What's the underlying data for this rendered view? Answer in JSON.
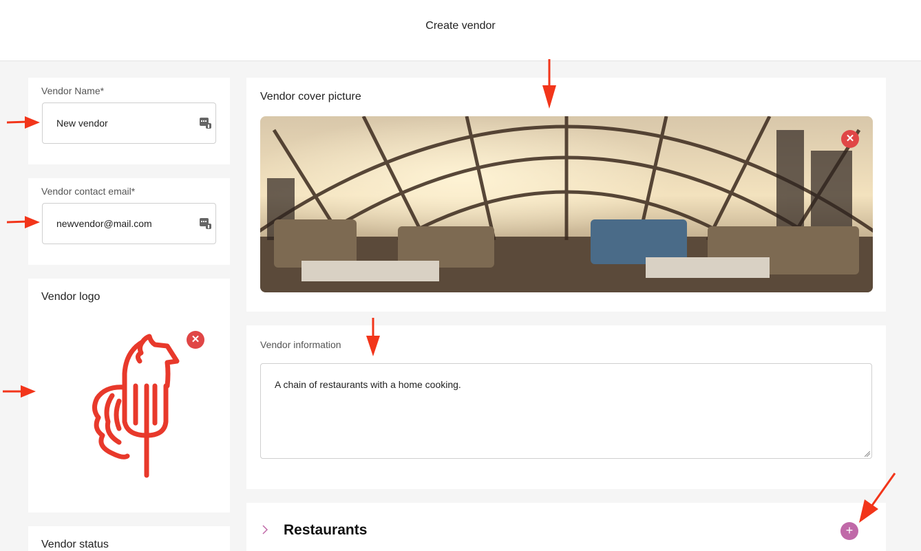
{
  "header": {
    "title": "Create vendor"
  },
  "vendor_name": {
    "label": "Vendor Name*",
    "value": "New vendor",
    "keyboard_icon": "keyboard-icon"
  },
  "vendor_email": {
    "label": "Vendor contact email*",
    "value": "newvendor@mail.com",
    "keyboard_icon": "keyboard-icon"
  },
  "vendor_logo": {
    "heading": "Vendor logo",
    "image_icon": "rooster-fork-logo",
    "remove_glyph": "✕"
  },
  "vendor_status": {
    "heading": "Vendor status"
  },
  "cover": {
    "heading": "Vendor cover picture",
    "image": "restaurant-glass-dome-photo",
    "remove_glyph": "✕"
  },
  "info": {
    "label": "Vendor information",
    "value": "A chain of restaurants with a home cooking."
  },
  "restaurants": {
    "title": "Restaurants",
    "add_glyph": "+",
    "expand_icon": "chevron-right-icon"
  },
  "colors": {
    "remove": "#e04646",
    "add": "#c069a8",
    "logo": "#e8392b",
    "annotation_arrow": "#f2351a"
  }
}
